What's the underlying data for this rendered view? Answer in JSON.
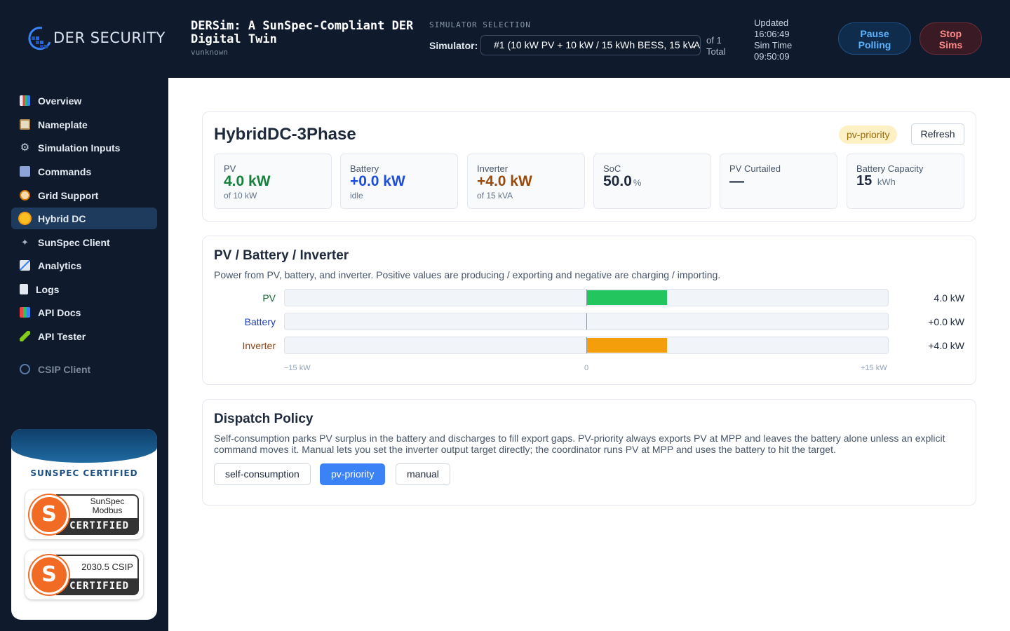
{
  "header": {
    "logo_text": "DER SECURITY",
    "title": "DERSim: A SunSpec-Compliant DER Digital Twin",
    "subtitle": "vunknown",
    "selection_heading": "SIMULATOR SELECTION",
    "simulator_label": "Simulator:",
    "simulator_value": "#1 (10 kW PV + 10 kW / 15 kWh BESS, 15 kVA",
    "count_line1": "of 1",
    "count_line2": "Total",
    "updated_label": "Updated",
    "updated_time": "16:06:49",
    "simtime_label": "Sim Time",
    "simtime_value": "09:50:09",
    "pause_line1": "Pause",
    "pause_line2": "Polling",
    "stop_line1": "Stop",
    "stop_line2": "Sims"
  },
  "sidebar": {
    "items": [
      {
        "label": "Overview",
        "icon": "chart-icon"
      },
      {
        "label": "Nameplate",
        "icon": "clipboard-icon"
      },
      {
        "label": "Simulation Inputs",
        "icon": "gear-icon"
      },
      {
        "label": "Commands",
        "icon": "control-knobs-icon"
      },
      {
        "label": "Grid Support",
        "icon": "gauge-icon"
      },
      {
        "label": "Hybrid DC",
        "icon": "sun-icon"
      },
      {
        "label": "SunSpec Client",
        "icon": "satellite-icon"
      },
      {
        "label": "Analytics",
        "icon": "trend-icon"
      },
      {
        "label": "Logs",
        "icon": "scroll-icon"
      },
      {
        "label": "API Docs",
        "icon": "books-icon"
      },
      {
        "label": "API Tester",
        "icon": "pen-icon"
      },
      {
        "label": "CSIP Client",
        "icon": "globe-icon"
      }
    ],
    "active": "Hybrid DC",
    "cert_title": "SUNSPEC CERTIFIED",
    "badge1_line1": "SunSpec",
    "badge1_line2": "Modbus",
    "badge1_cert": "CERTIFIED",
    "badge2_top": "2030.5 CSIP",
    "badge2_cert": "CERTIFIED"
  },
  "hybrid": {
    "title": "HybridDC-3Phase",
    "policy_tag": "pv-priority",
    "refresh": "Refresh",
    "stats": [
      {
        "label": "PV",
        "value": "4.0 kW",
        "sub": "of 10 kW",
        "color": "#16803c"
      },
      {
        "label": "Battery",
        "value": "+0.0 kW",
        "sub": "idle",
        "color": "#1d4ed8"
      },
      {
        "label": "Inverter",
        "value": "+4.0 kW",
        "sub": "of 15 kVA",
        "color": "#9a4a0b"
      },
      {
        "label": "SoC",
        "value": "50.0",
        "unit": "%",
        "sub": ""
      },
      {
        "label": "PV Curtailed",
        "value": "—",
        "sub": ""
      },
      {
        "label": "Battery Capacity",
        "value": "15",
        "unit": "kWh",
        "sub": ""
      }
    ]
  },
  "flow": {
    "title": "PV / Battery / Inverter",
    "description": "Power from PV, battery, and inverter. Positive values are producing / exporting and negative are charging / importing.",
    "range_kw": 15,
    "rows": [
      {
        "label": "PV",
        "kw": 4.0,
        "display": "4.0 kW",
        "label_color": "#166534",
        "bar_color": "#22c55e"
      },
      {
        "label": "Battery",
        "kw": 0.0,
        "display": "+0.0 kW",
        "label_color": "#1e40af",
        "bar_color": "#3b82f6"
      },
      {
        "label": "Inverter",
        "kw": 4.0,
        "display": "+4.0 kW",
        "label_color": "#92400e",
        "bar_color": "#f59e0b"
      }
    ],
    "axis_min": "−15 kW",
    "axis_mid": "0",
    "axis_max": "+15 kW"
  },
  "dispatch": {
    "title": "Dispatch Policy",
    "description": "Self-consumption parks PV surplus in the battery and discharges to fill export gaps. PV-priority always exports PV at MPP and leaves the battery alone unless an explicit command moves it. Manual lets you set the inverter output target directly; the coordinator runs PV at MPP and uses the battery to hit the target.",
    "options": [
      "self-consumption",
      "pv-priority",
      "manual"
    ],
    "selected": "pv-priority",
    "selected_color": "#3b82f6"
  }
}
